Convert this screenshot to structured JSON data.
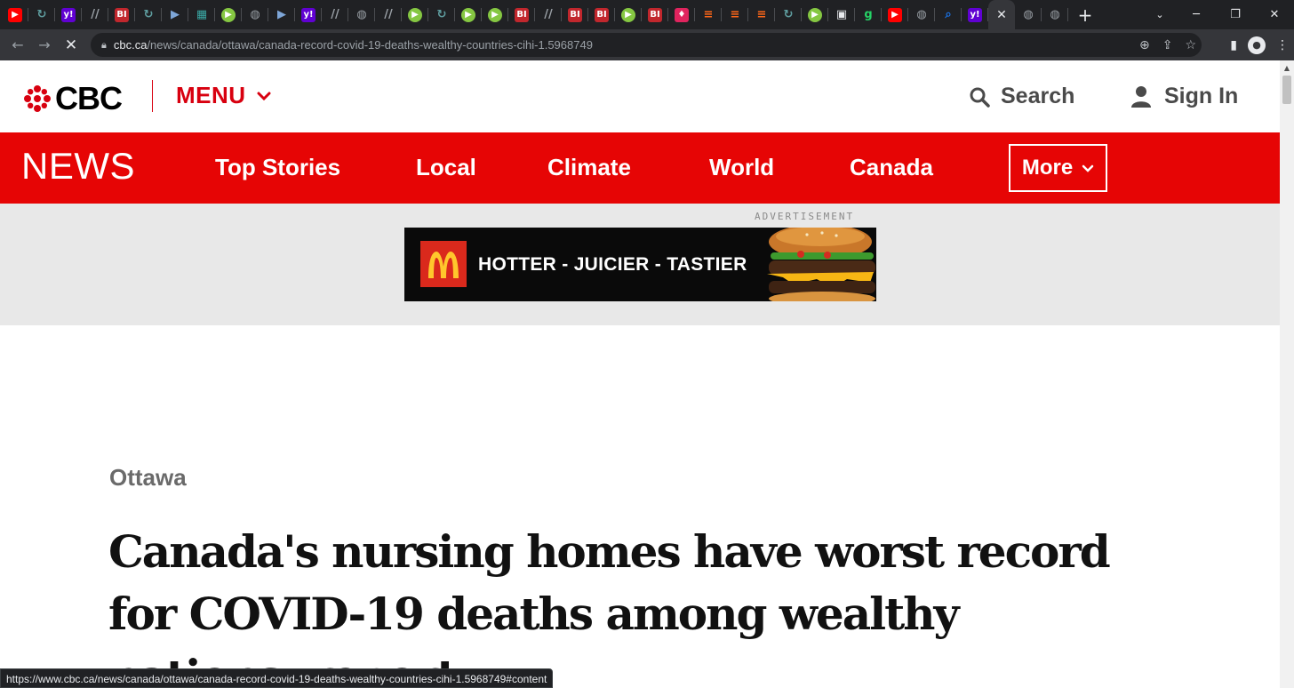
{
  "browser": {
    "tabs": [
      {
        "icon": "youtube-icon",
        "color": "#ff0000"
      },
      {
        "icon": "loop-icon",
        "color": "#5f9ea0"
      },
      {
        "icon": "yahoo-icon",
        "color": "#6001d2"
      },
      {
        "icon": "slash-icon",
        "color": "#9aa0a6"
      },
      {
        "icon": "bi-icon",
        "color": "#c1272d"
      },
      {
        "icon": "loop-icon",
        "color": "#5f9ea0"
      },
      {
        "icon": "play-arrow-icon",
        "color": "#7ea6d8"
      },
      {
        "icon": "grid-icon",
        "color": "#3aa6a3"
      },
      {
        "icon": "rumble-icon",
        "color": "#85c742"
      },
      {
        "icon": "globe-icon",
        "color": "#9aa0a6"
      },
      {
        "icon": "play-arrow-icon",
        "color": "#7ea6d8"
      },
      {
        "icon": "yahoo-icon",
        "color": "#6001d2"
      },
      {
        "icon": "slash-icon",
        "color": "#9aa0a6"
      },
      {
        "icon": "globe-icon",
        "color": "#9aa0a6"
      },
      {
        "icon": "slash-icon",
        "color": "#9aa0a6"
      },
      {
        "icon": "rumble-icon",
        "color": "#85c742"
      },
      {
        "icon": "loop-icon",
        "color": "#5f9ea0"
      },
      {
        "icon": "rumble-icon",
        "color": "#85c742"
      },
      {
        "icon": "rumble-icon",
        "color": "#85c742"
      },
      {
        "icon": "bi-icon",
        "color": "#c1272d"
      },
      {
        "icon": "slash-icon",
        "color": "#9aa0a6"
      },
      {
        "icon": "bi-icon",
        "color": "#c1272d"
      },
      {
        "icon": "bi-icon",
        "color": "#c1272d"
      },
      {
        "icon": "rumble-icon",
        "color": "#85c742"
      },
      {
        "icon": "bi-icon",
        "color": "#c1272d"
      },
      {
        "icon": "pin-icon",
        "color": "#e0245e"
      },
      {
        "icon": "bookmark-icon",
        "color": "#ff6719"
      },
      {
        "icon": "bookmark-icon",
        "color": "#ff6719"
      },
      {
        "icon": "bookmark-icon",
        "color": "#ff6719"
      },
      {
        "icon": "loop-icon",
        "color": "#5f9ea0"
      },
      {
        "icon": "rumble-icon",
        "color": "#85c742"
      },
      {
        "icon": "box-icon",
        "color": "#e8eaed"
      },
      {
        "icon": "g-icon",
        "color": "#25d366"
      },
      {
        "icon": "youtube-icon",
        "color": "#ff0000"
      },
      {
        "icon": "globe-icon",
        "color": "#9aa0a6"
      },
      {
        "icon": "magnifier-icon",
        "color": "#1a73e8"
      },
      {
        "icon": "yahoo-icon",
        "color": "#6001d2"
      }
    ],
    "active_tab_close": "✕",
    "after_tabs": [
      {
        "icon": "globe-icon",
        "color": "#9aa0a6"
      },
      {
        "icon": "globe-icon",
        "color": "#9aa0a6"
      }
    ],
    "new_tab": "+",
    "url_host": "cbc.ca",
    "url_path": "/news/canada/ottawa/canada-record-covid-19-deaths-wealthy-countries-cihi-1.5968749",
    "status_url": "https://www.cbc.ca/news/canada/ottawa/canada-record-covid-19-deaths-wealthy-countries-cihi-1.5968749#content"
  },
  "header": {
    "logo_text": "CBC",
    "menu_label": "MENU",
    "search_label": "Search",
    "signin_label": "Sign In"
  },
  "news_nav": {
    "brand": "NEWS",
    "items": [
      "Top Stories",
      "Local",
      "Climate",
      "World",
      "Canada"
    ],
    "more_label": "More"
  },
  "ad": {
    "label": "ADVERTISEMENT",
    "text": "HOTTER - JUICIER - TASTIER",
    "brand_color": "#da291c"
  },
  "article": {
    "section": "Ottawa",
    "headline": "Canada's nursing homes have worst record for COVID-19 deaths among wealthy nations: report"
  },
  "colors": {
    "cbc_red": "#e60505",
    "menu_red": "#d8000f"
  }
}
